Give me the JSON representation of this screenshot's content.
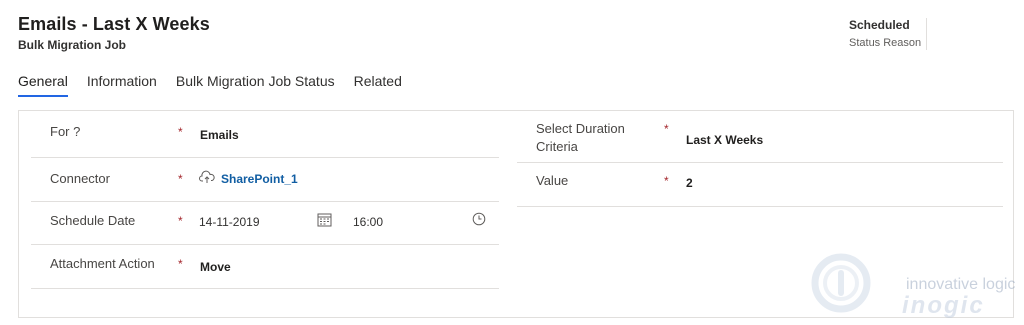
{
  "header": {
    "title": "Emails - Last X Weeks",
    "subtitle": "Bulk Migration Job"
  },
  "status": {
    "value": "Scheduled",
    "label": "Status Reason"
  },
  "tabs": [
    {
      "label": "General",
      "active": true
    },
    {
      "label": "Information",
      "active": false
    },
    {
      "label": "Bulk Migration Job Status",
      "active": false
    },
    {
      "label": "Related",
      "active": false
    }
  ],
  "form": {
    "left": {
      "for_label": "For ?",
      "for_value": "Emails",
      "connector_label": "Connector",
      "connector_value": "SharePoint_1",
      "schedule_label": "Schedule Date",
      "schedule_date": "14-11-2019",
      "schedule_time": "16:00",
      "attachment_label": "Attachment Action",
      "attachment_value": "Move"
    },
    "right": {
      "duration_label_line1": "Select Duration",
      "duration_label_line2": "Criteria",
      "duration_value": "Last X Weeks",
      "value_label": "Value",
      "value_value": "2"
    },
    "required_marker": "*"
  },
  "watermark": {
    "line1": "innovative logic",
    "line2": "inogic"
  },
  "icons": {
    "connector": "cloud-sync-icon",
    "calendar": "calendar-icon",
    "clock": "clock-icon"
  }
}
